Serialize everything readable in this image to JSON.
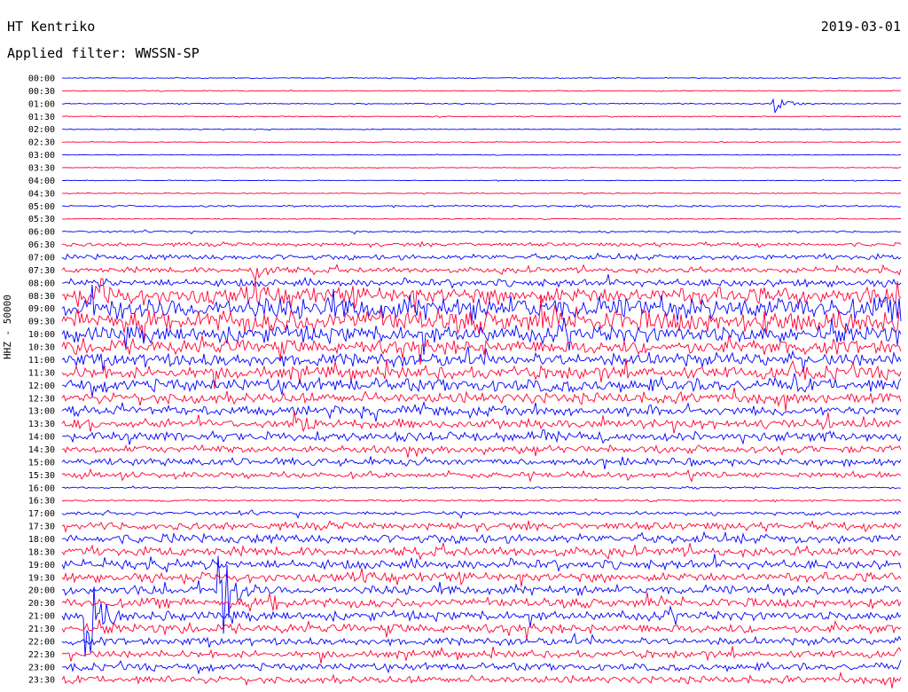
{
  "header": {
    "station": "HT Kentriko",
    "date": "2019-03-01",
    "filter_label": "Applied filter: WWSSN-SP"
  },
  "chart_data": {
    "type": "line",
    "ylabel": "HHZ - 50000",
    "row_labels": [
      "00:00",
      "00:30",
      "01:00",
      "01:30",
      "02:00",
      "02:30",
      "03:00",
      "03:30",
      "04:00",
      "04:30",
      "05:00",
      "05:30",
      "06:00",
      "06:30",
      "07:00",
      "07:30",
      "08:00",
      "08:30",
      "09:00",
      "09:30",
      "10:00",
      "10:30",
      "11:00",
      "11:30",
      "12:00",
      "12:30",
      "13:00",
      "13:30",
      "14:00",
      "14:30",
      "15:00",
      "15:30",
      "16:00",
      "16:30",
      "17:00",
      "17:30",
      "18:00",
      "18:30",
      "19:00",
      "19:30",
      "20:00",
      "20:30",
      "21:00",
      "21:30",
      "22:00",
      "22:30",
      "23:00",
      "23:30"
    ],
    "row_colors": [
      "#0000ff",
      "#ff0033"
    ],
    "amplitude_by_row": [
      0.5,
      0.5,
      0.6,
      0.5,
      0.4,
      0.4,
      0.4,
      0.4,
      0.4,
      0.5,
      1,
      0.5,
      1,
      2,
      3,
      3,
      4,
      9,
      12,
      12,
      9,
      8,
      7,
      7,
      7,
      6,
      5,
      5,
      5,
      4,
      4,
      3,
      1,
      1,
      2,
      4,
      5,
      5,
      5,
      5,
      5,
      5,
      5,
      5,
      4,
      4,
      4,
      4
    ],
    "events": [
      {
        "row": 2,
        "x_frac": 0.85,
        "amplitude": 10
      },
      {
        "row": 15,
        "x_frac": 0.23,
        "amplitude": 14
      },
      {
        "row": 17,
        "x_frac": 0.05,
        "amplitude": 12
      },
      {
        "row": 27,
        "x_frac": 0.28,
        "amplitude": 16
      },
      {
        "row": 42,
        "x_frac": 0.03,
        "amplitude": 60
      },
      {
        "row": 40,
        "x_frac": 0.19,
        "amplitude": 60
      },
      {
        "row": 41,
        "x_frac": 0.25,
        "amplitude": 10
      }
    ]
  },
  "colors": {
    "trace_even": "#0000ff",
    "trace_odd": "#ff0033",
    "background": "#ffffff"
  }
}
